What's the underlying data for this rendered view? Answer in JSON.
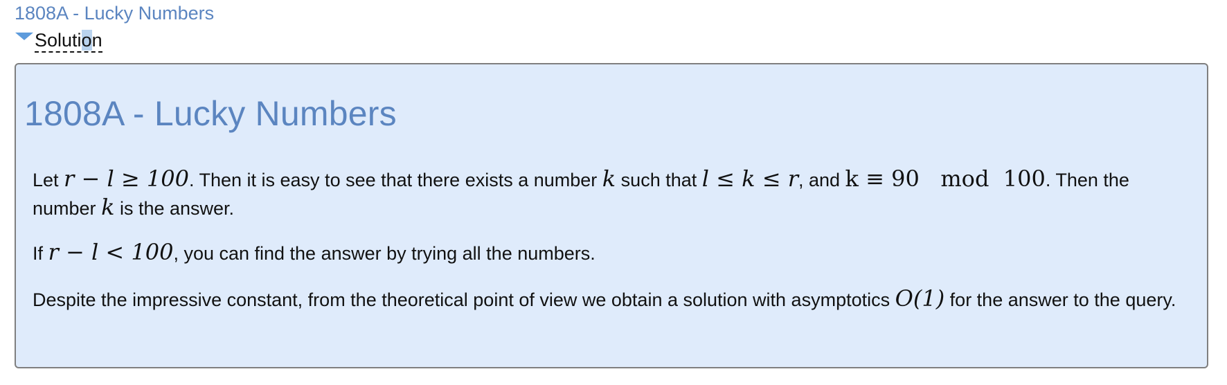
{
  "page": {
    "link_title": "1808A - Lucky Numbers"
  },
  "spoiler": {
    "label_before": "Soluti",
    "label_selected": "o",
    "label_after": "n"
  },
  "solution": {
    "title": "1808A - Lucky Numbers",
    "p1": {
      "t1": "Let ",
      "m1": "r − l ≥ 100",
      "t2": ". Then it is easy to see that there exists a number ",
      "m2": "k",
      "t3": " such that ",
      "m3": "l ≤ k ≤ r",
      "t4": ", and ",
      "m4": "k ≡ 90   mod  100",
      "t5": ". Then the number ",
      "m5": "k",
      "t6": " is the answer."
    },
    "p2": {
      "t1": "If ",
      "m1": "r − l < 100",
      "t2": ", you can find the answer by trying all the numbers."
    },
    "p3": {
      "t1": "Despite the impressive constant, from the theoretical point of view we obtain a solution with asymptotics ",
      "m1": "O(1)",
      "t2": " for the answer to the query."
    }
  }
}
